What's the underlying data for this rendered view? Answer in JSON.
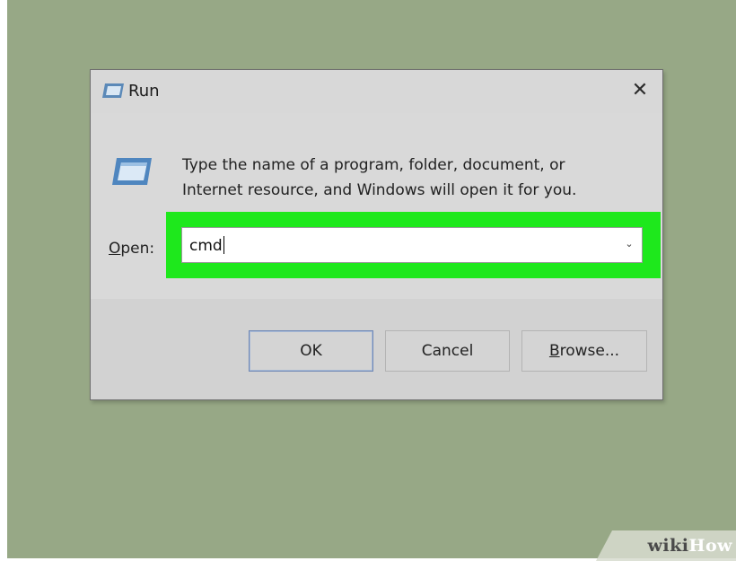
{
  "window": {
    "title": "Run",
    "close_icon": "close-icon",
    "app_icon": "run-icon"
  },
  "content": {
    "description_line1": "Type the name of a program, folder, document, or",
    "description_line2": "Internet resource, and Windows will open it for you.",
    "open_label": "Open:",
    "open_label_underline_char": "O",
    "open_label_rest": "pen:",
    "combo_value": "cmd",
    "combo_arrow_icon": "chevron-down-icon"
  },
  "buttons": {
    "ok_label": "OK",
    "cancel_label": "Cancel",
    "browse_label": "Browse...",
    "browse_underline_char": "B",
    "browse_rest": "rowse..."
  },
  "watermark": {
    "wiki": "wiki",
    "how": "How"
  },
  "colors": {
    "desktop": "#97a886",
    "highlight": "#1ee81c",
    "dialog": "#d8d8d8"
  }
}
